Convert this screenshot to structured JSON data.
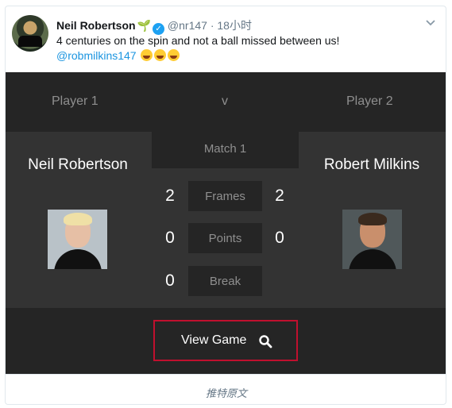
{
  "tweet": {
    "author_name": "Neil Robertson",
    "handle": "@nr147",
    "separator": "·",
    "time": "18小时",
    "text": "4 centuries on the spin and not a ball missed between us!",
    "mention": "@robmilkins147",
    "emoji_icon": "tears-of-joy-emoji"
  },
  "scoreboard": {
    "player1_label": "Player 1",
    "vs_label": "v",
    "player2_label": "Player 2",
    "match_label": "Match 1",
    "player1_name": "Neil Robertson",
    "player2_name": "Robert Milkins",
    "stats": [
      {
        "label": "Frames",
        "p1": "2",
        "p2": "2"
      },
      {
        "label": "Points",
        "p1": "0",
        "p2": "0"
      },
      {
        "label": "Break",
        "p1": "0",
        "p2": ""
      }
    ],
    "view_button_label": "View Game",
    "accent_color": "#c0102e"
  },
  "translate_link": "推特原文"
}
